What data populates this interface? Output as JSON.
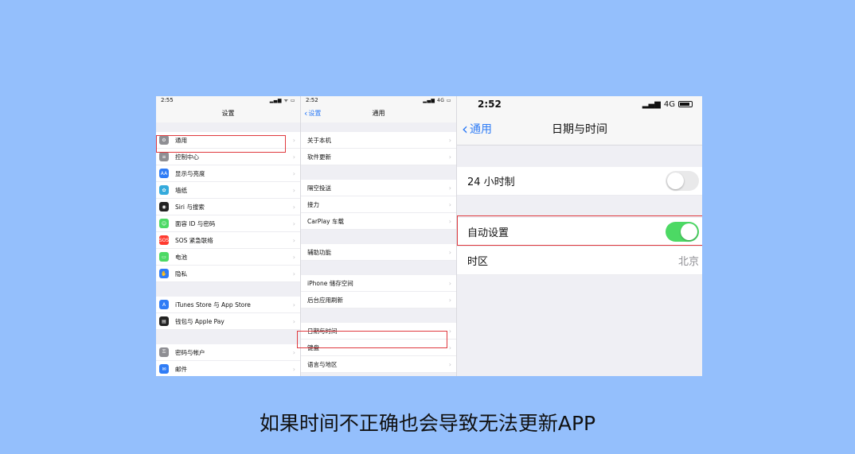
{
  "caption": "如果时间不正确也会导致无法更新APP",
  "panel1": {
    "time": "2:55",
    "status_icons": "▂▄▆ ᯤ ▭",
    "title": "设置",
    "groups": [
      [
        {
          "label": "通用",
          "icon": "gear-icon",
          "color": "#8e8e93"
        },
        {
          "label": "控制中心",
          "icon": "toggles-icon",
          "color": "#8e8e93"
        },
        {
          "label": "显示与亮度",
          "icon": "AA",
          "color": "#2f7cf6"
        },
        {
          "label": "墙纸",
          "icon": "flower-icon",
          "color": "#34aadc"
        },
        {
          "label": "Siri 与搜索",
          "icon": "siri-icon",
          "color": "#222"
        },
        {
          "label": "面容 ID 与密码",
          "icon": "face-id-icon",
          "color": "#4cd964"
        },
        {
          "label": "SOS 紧急联络",
          "icon": "SOS",
          "color": "#ff3b30"
        },
        {
          "label": "电池",
          "icon": "battery-icon",
          "color": "#4cd964"
        },
        {
          "label": "隐私",
          "icon": "hand-icon",
          "color": "#2f7cf6"
        }
      ],
      [
        {
          "label": "iTunes Store 与 App Store",
          "icon": "app-store-icon",
          "color": "#2f7cf6"
        },
        {
          "label": "钱包与 Apple Pay",
          "icon": "wallet-icon",
          "color": "#222"
        }
      ],
      [
        {
          "label": "密码与帐户",
          "icon": "key-icon",
          "color": "#8e8e93"
        },
        {
          "label": "邮件",
          "icon": "mail-icon",
          "color": "#2f7cf6"
        }
      ]
    ]
  },
  "panel2": {
    "time": "2:52",
    "status_icons": "▂▄▆ 4G ▭",
    "back": "设置",
    "title": "通用",
    "groups": [
      [
        "关于本机",
        "软件更新"
      ],
      [
        "隔空投送",
        "接力",
        "CarPlay 车载"
      ],
      [
        "辅助功能"
      ],
      [
        "iPhone 储存空间",
        "后台应用刷新"
      ],
      [
        "日期与时间",
        "键盘",
        "语言与地区"
      ]
    ]
  },
  "panel3": {
    "time": "2:52",
    "network": "4G",
    "back": "通用",
    "title": "日期与时间",
    "rows": {
      "hour24": {
        "label": "24 小时制",
        "on": false
      },
      "auto": {
        "label": "自动设置",
        "on": true
      },
      "timezone": {
        "label": "时区",
        "value": "北京"
      }
    }
  }
}
